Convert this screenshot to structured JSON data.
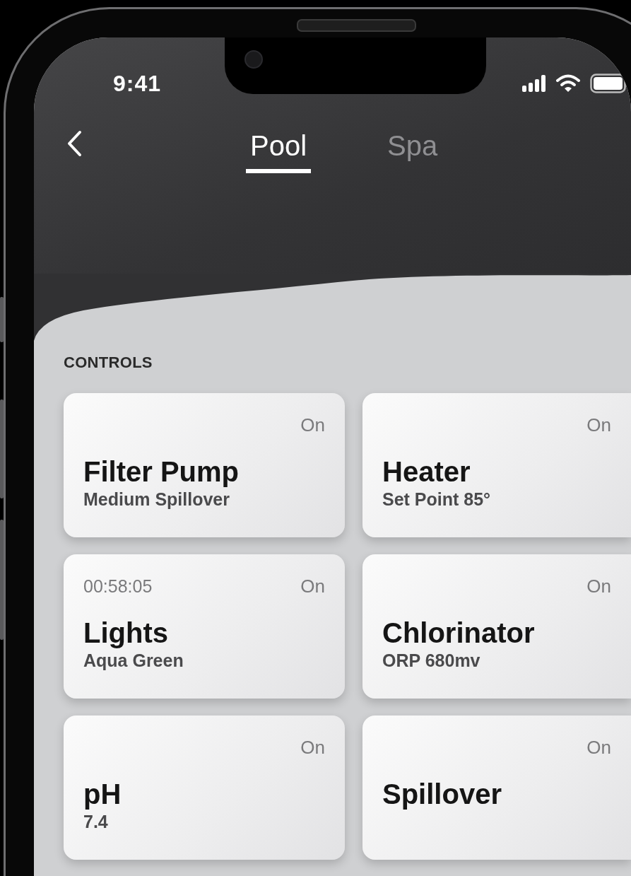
{
  "status_bar": {
    "time": "9:41"
  },
  "tabs": [
    {
      "label": "Pool",
      "selected": true
    },
    {
      "label": "Spa",
      "selected": false
    }
  ],
  "section_title": "CONTROLS",
  "controls": [
    {
      "name": "Filter Pump",
      "detail": "Medium Spillover",
      "status": "On"
    },
    {
      "name": "Heater",
      "detail": "Set Point 85°",
      "status": "On"
    },
    {
      "name": "Lights",
      "detail": "Aqua Green",
      "status": "On",
      "timer": "00:58:05"
    },
    {
      "name": "Chlorinator",
      "detail": "ORP 680mv",
      "status": "On"
    },
    {
      "name": "pH",
      "detail": "7.4",
      "status": "On"
    },
    {
      "name": "Spillover",
      "status": "On"
    }
  ]
}
